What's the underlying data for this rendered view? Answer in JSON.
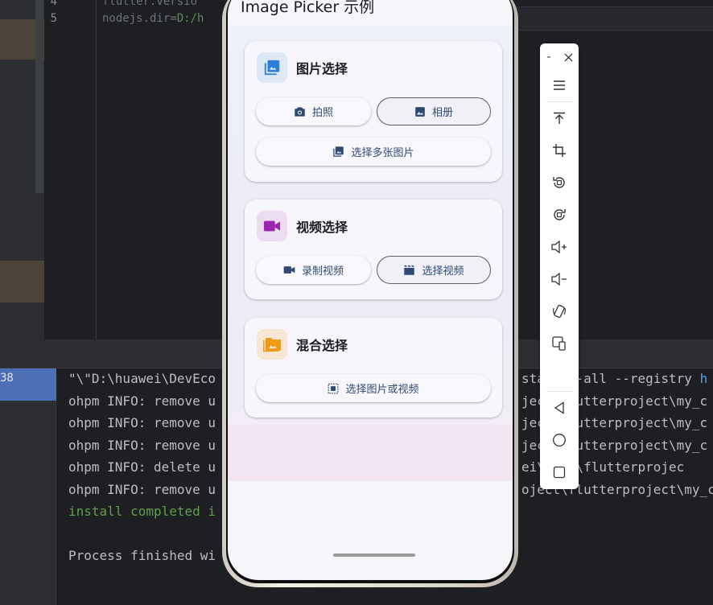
{
  "ide": {
    "editor": {
      "line_numbers": [
        "4",
        "5"
      ],
      "line4_partial": "flutter.versio",
      "line5_key": "nodejs.dir=",
      "line5_val": "D:/h"
    },
    "console": {
      "run_label": "38",
      "lines": [
        "\"\\\"D:\\huawei\\DevEco",
        "ohpm INFO: remove u",
        "ohpm INFO: remove u",
        "ohpm INFO: remove u",
        "ohpm INFO: delete u",
        "ohpm INFO: remove u",
        "install completed i",
        "",
        "Process finished wi"
      ],
      "right_lines": [
        "sta    -all --registry ",
        "ject\\flutterproject\\my_c",
        "ject\\flutterproject\\my_c",
        "ject\\flutterproject\\my_c",
        "ei\\ject\\flutterprojec",
        "oject\\flutterproject\\my_c"
      ],
      "right_link": "h"
    }
  },
  "app": {
    "title": "Image Picker 示例",
    "sections": [
      {
        "title": "图片选择",
        "icon": "photo-library-icon",
        "color": "#2f7fd6",
        "buttons": [
          {
            "label": "拍照",
            "icon": "camera-icon",
            "style": "elevated"
          },
          {
            "label": "相册",
            "icon": "image-icon",
            "style": "outlined"
          },
          {
            "label": "选择多张图片",
            "icon": "photo-library-icon",
            "style": "elevated"
          }
        ]
      },
      {
        "title": "视频选择",
        "icon": "videocam-icon",
        "color": "#9b27b0",
        "buttons": [
          {
            "label": "录制视频",
            "icon": "videocam-icon",
            "style": "elevated"
          },
          {
            "label": "选择视频",
            "icon": "video-clapper-icon",
            "style": "outlined"
          }
        ]
      },
      {
        "title": "混合选择",
        "icon": "perm-media-icon",
        "color": "#f19a17",
        "buttons": [
          {
            "label": "选择图片或视频",
            "icon": "select-all-icon",
            "style": "elevated"
          }
        ]
      }
    ]
  },
  "emulator_toolbar": {
    "buttons": [
      {
        "id": "minimize",
        "icon": "minimize-icon",
        "glyph": "-"
      },
      {
        "id": "close",
        "icon": "close-icon",
        "glyph": "×"
      },
      {
        "id": "menu",
        "icon": "menu-icon"
      },
      {
        "id": "pin-top",
        "icon": "pin-top-icon"
      },
      {
        "id": "screenshot",
        "icon": "crop-icon"
      },
      {
        "id": "rotate-left",
        "icon": "rotate-left-icon"
      },
      {
        "id": "rotate-right",
        "icon": "rotate-right-icon"
      },
      {
        "id": "volume-up",
        "icon": "volume-up-icon"
      },
      {
        "id": "volume-down",
        "icon": "volume-down-icon"
      },
      {
        "id": "shake",
        "icon": "shake-icon"
      },
      {
        "id": "multi-screen",
        "icon": "multi-device-icon"
      },
      {
        "id": "back",
        "icon": "back-icon"
      },
      {
        "id": "home",
        "icon": "home-icon"
      },
      {
        "id": "recent",
        "icon": "recent-apps-icon"
      }
    ]
  }
}
